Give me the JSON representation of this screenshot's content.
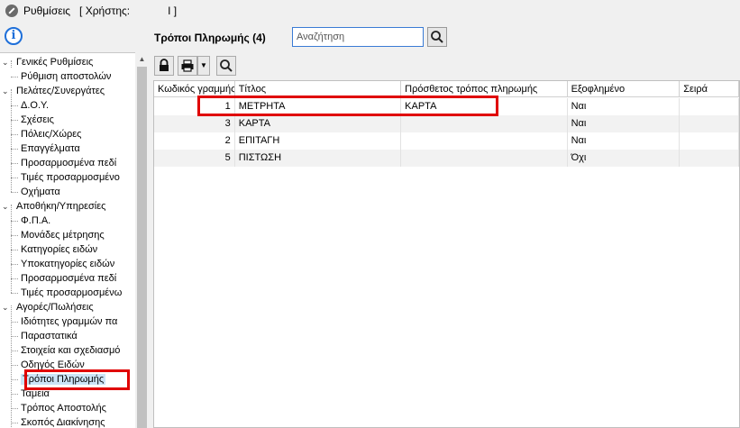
{
  "window": {
    "title": "Ρυθμίσεις",
    "user_label": "[ Χρήστης:",
    "user_value": "I ]"
  },
  "tree": {
    "groups": [
      {
        "label": "Γενικές Ρυθμίσεις",
        "children": [
          "Ρύθμιση αποστολών"
        ]
      },
      {
        "label": "Πελάτες/Συνεργάτες",
        "children": [
          "Δ.Ο.Υ.",
          "Σχέσεις",
          "Πόλεις/Χώρες",
          "Επαγγέλματα",
          "Προσαρμοσμένα πεδί",
          "Τιμές προσαρμοσμένο",
          "Οχήματα"
        ]
      },
      {
        "label": "Αποθήκη/Υπηρεσίες",
        "children": [
          "Φ.Π.Α.",
          "Μονάδες μέτρησης",
          "Κατηγορίες ειδών",
          "Υποκατηγορίες ειδών",
          "Προσαρμοσμένα πεδί",
          "Τιμές προσαρμοσμένω"
        ]
      },
      {
        "label": "Αγορές/Πωλήσεις",
        "children": [
          "Ιδιότητες γραμμών πα",
          "Παραστατικά",
          "Στοιχεία και σχεδιασμό",
          "Οδηγός Ειδών",
          "Τρόποι Πληρωμής",
          "Ταμεία",
          "Τρόπος Αποστολής",
          "Σκοπός Διακίνησης"
        ]
      }
    ],
    "selected": "Τρόποι Πληρωμής"
  },
  "pane": {
    "title": "Τρόποι Πληρωμής (4)",
    "search_placeholder": "Αναζήτηση"
  },
  "grid": {
    "columns": [
      "Κωδικός γραμμής",
      "Τίτλος",
      "Πρόσθετος τρόπος πληρωμής",
      "Εξοφλημένο",
      "Σειρά"
    ],
    "rows": [
      {
        "code": "1",
        "title": "ΜΕΤΡΗΤΑ",
        "extra": "ΚΑΡΤΑ",
        "paid": "Ναι",
        "seq": ""
      },
      {
        "code": "3",
        "title": "ΚΑΡΤΑ",
        "extra": "",
        "paid": "Ναι",
        "seq": ""
      },
      {
        "code": "2",
        "title": "ΕΠΙΤΑΓΗ",
        "extra": "",
        "paid": "Ναι",
        "seq": ""
      },
      {
        "code": "5",
        "title": "ΠΙΣΤΩΣΗ",
        "extra": "",
        "paid": "Όχι",
        "seq": ""
      }
    ]
  },
  "colors": {
    "highlight": "#e00000",
    "selection": "#cce4f7",
    "accent": "#1e6fd9"
  },
  "icons": [
    "settings-app-icon",
    "info-icon",
    "search-icon",
    "lock-icon",
    "print-icon",
    "chevron-down-icon",
    "search-icon"
  ]
}
